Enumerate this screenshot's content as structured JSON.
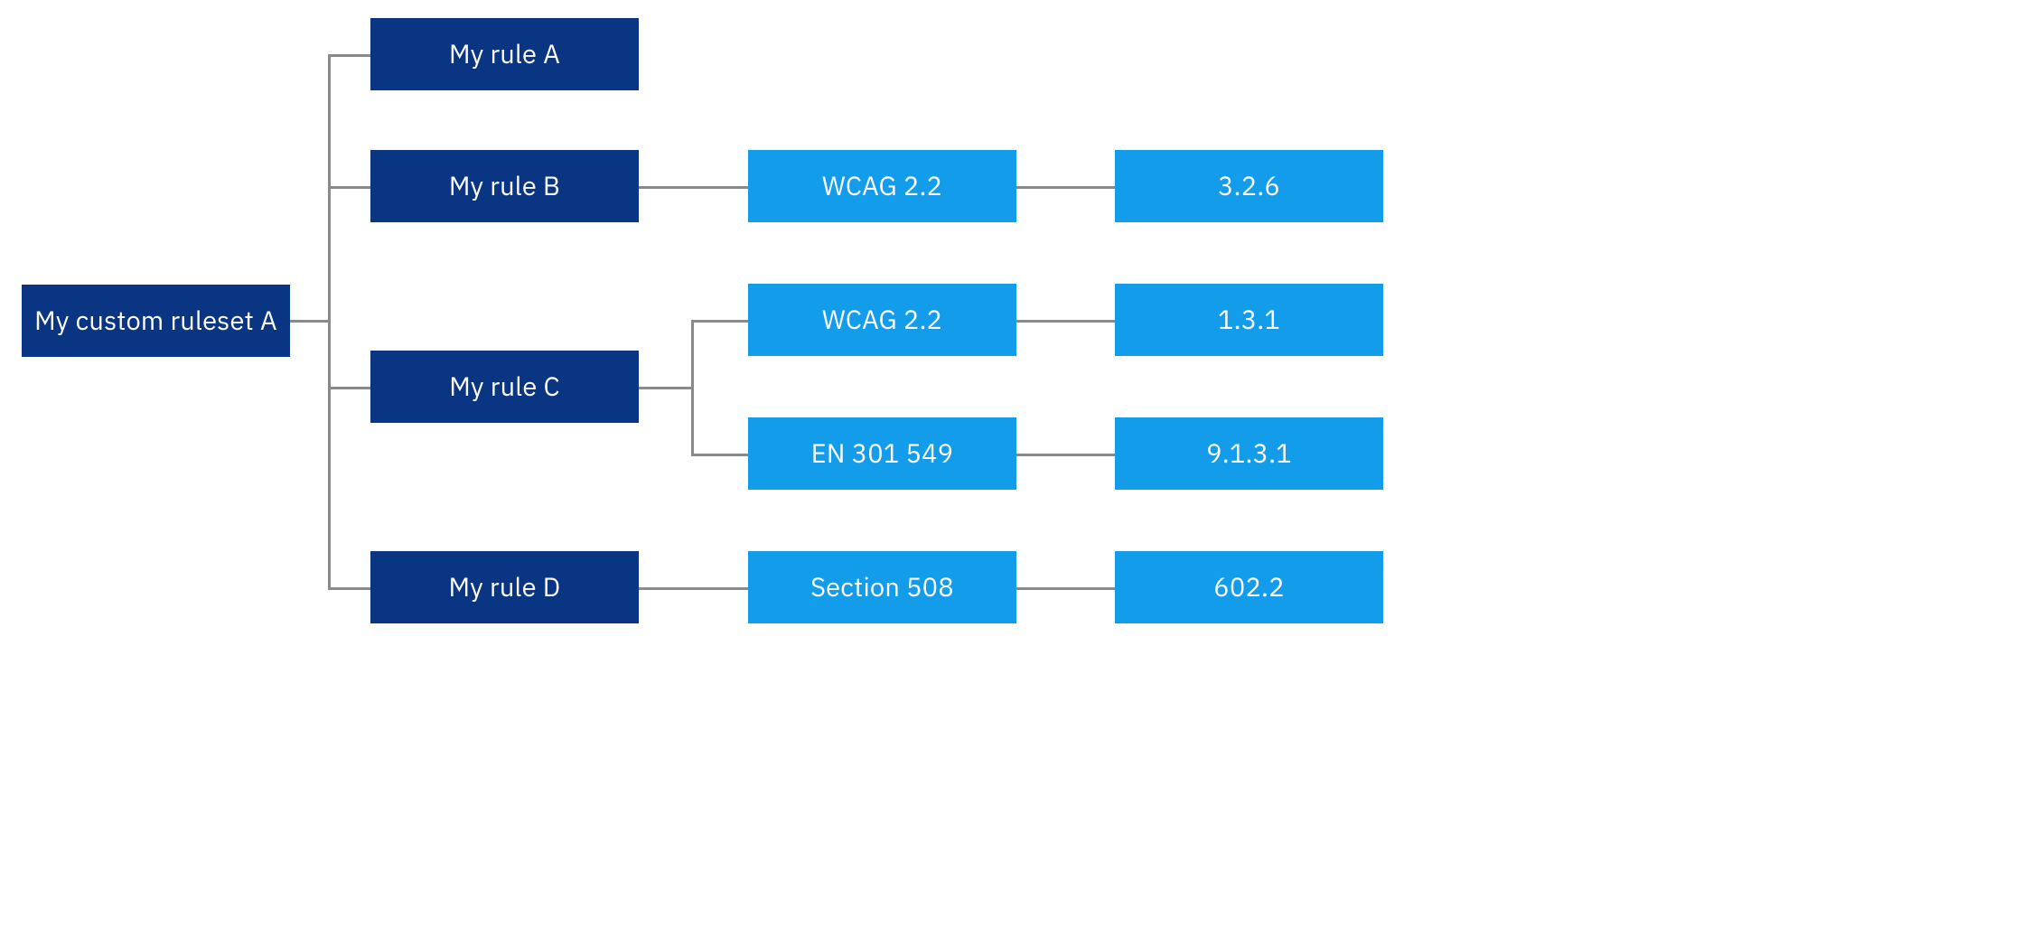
{
  "colors": {
    "dark_blue": "#0a3582",
    "light_blue": "#129cea",
    "connector": "#8a8a8a"
  },
  "ruleset": {
    "label": "My custom ruleset A"
  },
  "rules": {
    "a": {
      "label": "My rule A"
    },
    "b": {
      "label": "My rule B",
      "standard": {
        "label": "WCAG 2.2"
      },
      "criterion": {
        "label": "3.2.6"
      }
    },
    "c": {
      "label": "My rule C",
      "standards": [
        {
          "name": "WCAG 2.2",
          "criterion": "1.3.1"
        },
        {
          "name": "EN 301 549",
          "criterion": "9.1.3.1"
        }
      ]
    },
    "d": {
      "label": "My rule D",
      "standard": {
        "label": "Section 508"
      },
      "criterion": {
        "label": "602.2"
      }
    }
  }
}
